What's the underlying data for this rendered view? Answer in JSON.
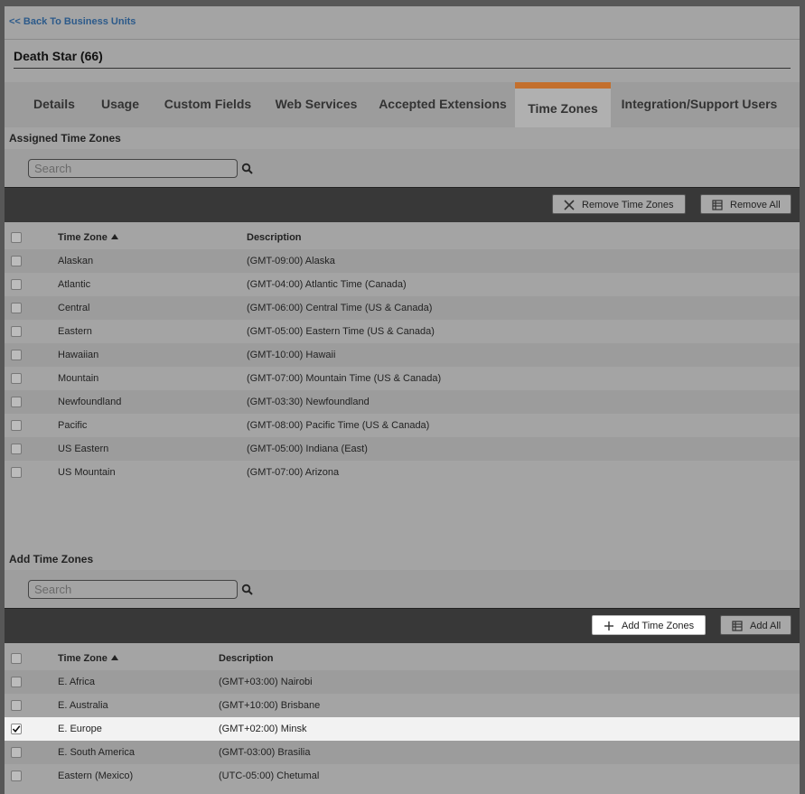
{
  "nav": {
    "back_label": "<< Back To Business Units"
  },
  "business_unit": {
    "title": "Death Star (66)"
  },
  "tabs": [
    {
      "label": "Details"
    },
    {
      "label": "Usage"
    },
    {
      "label": "Custom Fields"
    },
    {
      "label": "Web Services"
    },
    {
      "label": "Accepted Extensions"
    },
    {
      "label": "Time Zones"
    },
    {
      "label": "Integration/Support Users"
    }
  ],
  "assigned": {
    "title": "Assigned Time Zones",
    "search_placeholder": "Search",
    "search_value": "",
    "remove_label": "Remove Time Zones",
    "remove_all_label": "Remove All",
    "col_timezone": "Time Zone",
    "col_description": "Description",
    "rows": [
      {
        "tz": "Alaskan",
        "desc": "(GMT-09:00) Alaska"
      },
      {
        "tz": "Atlantic",
        "desc": "(GMT-04:00) Atlantic Time (Canada)"
      },
      {
        "tz": "Central",
        "desc": "(GMT-06:00) Central Time (US & Canada)"
      },
      {
        "tz": "Eastern",
        "desc": "(GMT-05:00) Eastern Time (US & Canada)"
      },
      {
        "tz": "Hawaiian",
        "desc": "(GMT-10:00) Hawaii"
      },
      {
        "tz": "Mountain",
        "desc": "(GMT-07:00) Mountain Time (US & Canada)"
      },
      {
        "tz": "Newfoundland",
        "desc": "(GMT-03:30) Newfoundland"
      },
      {
        "tz": "Pacific",
        "desc": "(GMT-08:00) Pacific Time (US & Canada)"
      },
      {
        "tz": "US Eastern",
        "desc": "(GMT-05:00) Indiana (East)"
      },
      {
        "tz": "US Mountain",
        "desc": "(GMT-07:00) Arizona"
      }
    ]
  },
  "available": {
    "title": "Add Time Zones",
    "search_placeholder": "Search",
    "search_value": "",
    "add_label": "Add Time Zones",
    "add_all_label": "Add All",
    "col_timezone": "Time Zone",
    "col_description": "Description",
    "rows": [
      {
        "tz": "E. Africa",
        "desc": "(GMT+03:00) Nairobi"
      },
      {
        "tz": "E. Australia",
        "desc": "(GMT+10:00) Brisbane"
      },
      {
        "tz": "E. Europe",
        "desc": "(GMT+02:00) Minsk"
      },
      {
        "tz": "E. South America",
        "desc": "(GMT-03:00) Brasilia"
      },
      {
        "tz": "Eastern (Mexico)",
        "desc": "(UTC-05:00) Chetumal"
      }
    ]
  },
  "colors": {
    "active_tab_accent": "#c36f2d",
    "toolbar_bg": "#383838",
    "selected_row_bg": "#f2f2f2"
  }
}
